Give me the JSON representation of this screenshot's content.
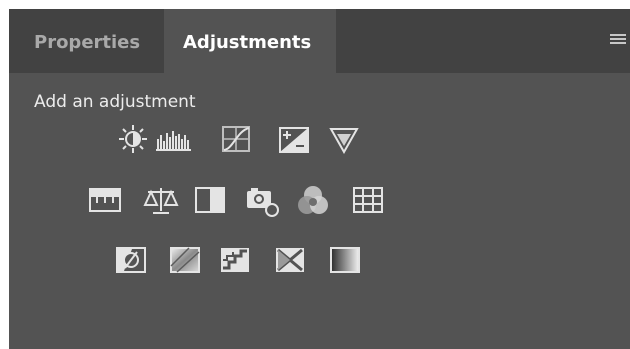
{
  "tabs": [
    {
      "label": "Properties",
      "active": false
    },
    {
      "label": "Adjustments",
      "active": true
    }
  ],
  "menu_icon": "panel-menu-icon",
  "add_label": "Add an adjustment",
  "rows": [
    [
      "brightness-contrast-icon",
      "levels-icon",
      "curves-icon",
      "exposure-icon",
      "vibrance-icon"
    ],
    [
      "hue-saturation-icon",
      "color-balance-icon",
      "black-white-icon",
      "photo-filter-icon",
      "channel-mixer-icon",
      "color-lookup-icon"
    ],
    [
      "invert-icon",
      "posterize-icon",
      "threshold-icon",
      "selective-color-icon",
      "gradient-map-icon"
    ]
  ],
  "colors": {
    "panel": "#535353",
    "tabbar": "#424242",
    "text": "#ececec",
    "icon": "#e4e4e4"
  }
}
